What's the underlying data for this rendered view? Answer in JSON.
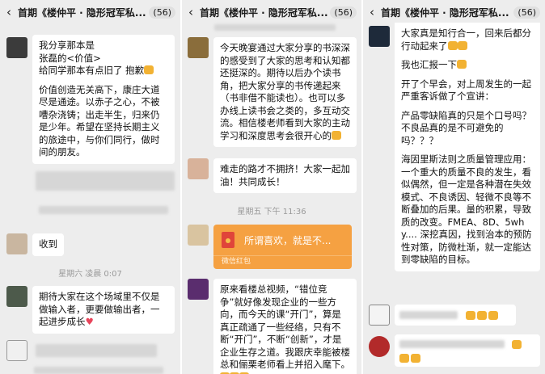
{
  "chat_title": "首期《楼仲平 · 隐形冠军私...",
  "member_count": "(56)",
  "back_glyph": "‹",
  "panel1": {
    "bubble1": {
      "lines": [
        "我分享那本是",
        "张磊的<价值>",
        "给同学那本有点旧了 抱歉",
        "价值创造无关高下，康庄大道尽是通途。以赤子之心，不被嘈杂浇铸；出走半生，归来仍是少年。希望在坚持长期主义的旅途中，与你们同行，做时间的朋友。"
      ]
    },
    "bubble2": {
      "text": "收到"
    },
    "timestamp": "星期六 凌晨 0:07",
    "bubble3": {
      "text": "期待大家在这个场域里不仅是做输入者，更要做输出者，一起进步成长"
    }
  },
  "panel2": {
    "bubble1": {
      "text": "今天晚宴通过大家分享的书深深的感受到了大家的思考和认知都还挺深的。期待以后办个读书角，把大家分享的书传递起来（书非借不能读也）。也可以多办线上读书会之类的，多互动交流。相信楼老师看到大家的主动学习和深度思考会很开心的"
    },
    "bubble2": {
      "text": "难走的路才不拥挤！大家一起加油！共同成长！"
    },
    "timestamp": "星期五 下午 11:36",
    "red_packet": {
      "text": "所谓喜欢，就是不...",
      "footer": "微信红包"
    },
    "bubble3": {
      "text": "原来看楼总视频，“错位竞争”就好像发现企业的一些方向，而今天的课“开门”，算是真正疏通了一些经络，只有不断“开门”，不断“创新”，才是企业生存之道。我跟庆幸能被楼总和俪栗老师看上并招入麾下。"
    }
  },
  "panel3": {
    "bubble1": {
      "lines": [
        "大家真是知行合一，回来后都分行动起来了",
        "我也汇报一下",
        "开了个早会，对上周发生的一起严重客诉做了个宣讲：",
        "产品零缺陷真的只是个口号吗？不良品真的是不可避免的吗？？？",
        "海因里斯法则之质量管理应用：一个重大的质量不良的发生，看似偶然，但一定是各种潜在失效模式、不良诱因、轻微不良等不断叠加的后果。量的积累，导致质的改变。FMEA、8D、5why.... 深挖真因，找到治本的预防性对策，防微杜渐，就一定能达到零缺陷的目标。"
      ]
    }
  }
}
